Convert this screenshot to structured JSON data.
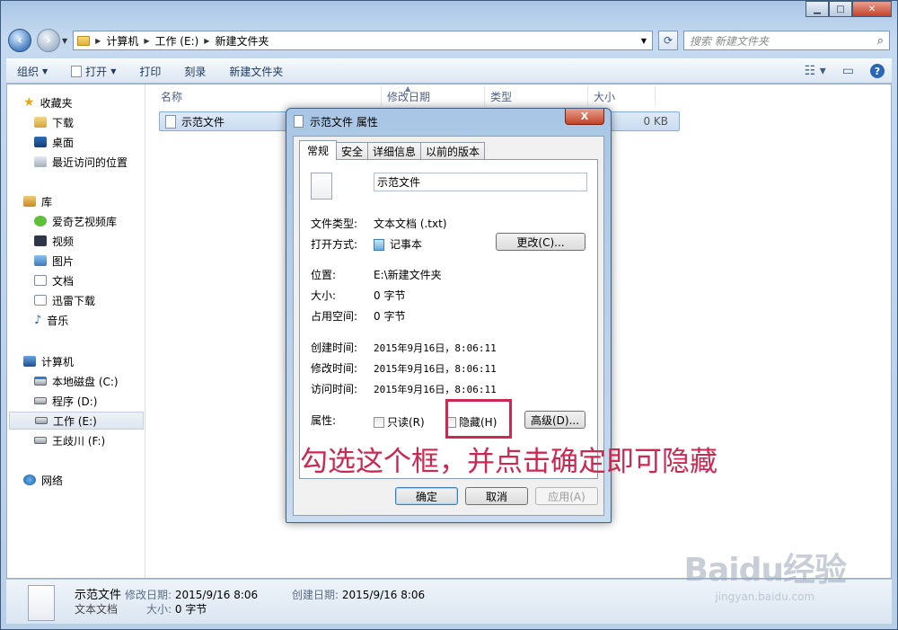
{
  "explorer": {
    "breadcrumbs": [
      "计算机",
      "工作 (E:)",
      "新建文件夹"
    ],
    "search_placeholder": "搜索 新建文件夹",
    "commands": {
      "organize": "组织",
      "open": "打开",
      "print": "打印",
      "burn": "刻录",
      "new_folder": "新建文件夹"
    },
    "columns": [
      "名称",
      "修改日期",
      "类型",
      "大小"
    ],
    "file": {
      "name": "示范文件",
      "size": "0 KB"
    },
    "nav": {
      "favorites": {
        "header": "收藏夹",
        "items": [
          "下载",
          "桌面",
          "最近访问的位置"
        ]
      },
      "libraries": {
        "header": "库",
        "items": [
          "爱奇艺视频库",
          "视频",
          "图片",
          "文档",
          "迅雷下载",
          "音乐"
        ]
      },
      "computer": {
        "header": "计算机",
        "items": [
          "本地磁盘 (C:)",
          "程序 (D:)",
          "工作 (E:)",
          "王歧川 (F:)"
        ]
      },
      "network": "网络"
    },
    "details": {
      "name": "示范文件",
      "type": "文本文档",
      "modified_label": "修改日期:",
      "modified": "2015/9/16 8:06",
      "size_label": "大小:",
      "size": "0 字节",
      "created_label": "创建日期:",
      "created": "2015/9/16 8:06"
    }
  },
  "dialog": {
    "title": "示范文件 属性",
    "close": "X",
    "tabs": [
      "常规",
      "安全",
      "详细信息",
      "以前的版本"
    ],
    "filename": "示范文件",
    "rows": {
      "filetype_label": "文件类型:",
      "filetype": "文本文档 (.txt)",
      "openwith_label": "打开方式:",
      "openwith": "记事本",
      "change_button": "更改(C)...",
      "location_label": "位置:",
      "location": "E:\\新建文件夹",
      "size_label": "大小:",
      "size": "0 字节",
      "disksize_label": "占用空间:",
      "disksize": "0 字节",
      "created_label": "创建时间:",
      "created": "2015年9月16日，8:06:11",
      "modified_label": "修改时间:",
      "modified": "2015年9月16日，8:06:11",
      "accessed_label": "访问时间:",
      "accessed": "2015年9月16日，8:06:11",
      "attributes_label": "属性:",
      "readonly": "只读(R)",
      "hidden": "隐藏(H)",
      "advanced_button": "高级(D)..."
    },
    "buttons": {
      "ok": "确定",
      "cancel": "取消",
      "apply": "应用(A)"
    }
  },
  "annotation": "勾选这个框，并点击确定即可隐藏",
  "watermark": {
    "logo": "Baidu经验",
    "url": "jingyan.baidu.com"
  },
  "colors": {
    "annotation": "#cc2952",
    "selection": "#c9dcf2"
  }
}
